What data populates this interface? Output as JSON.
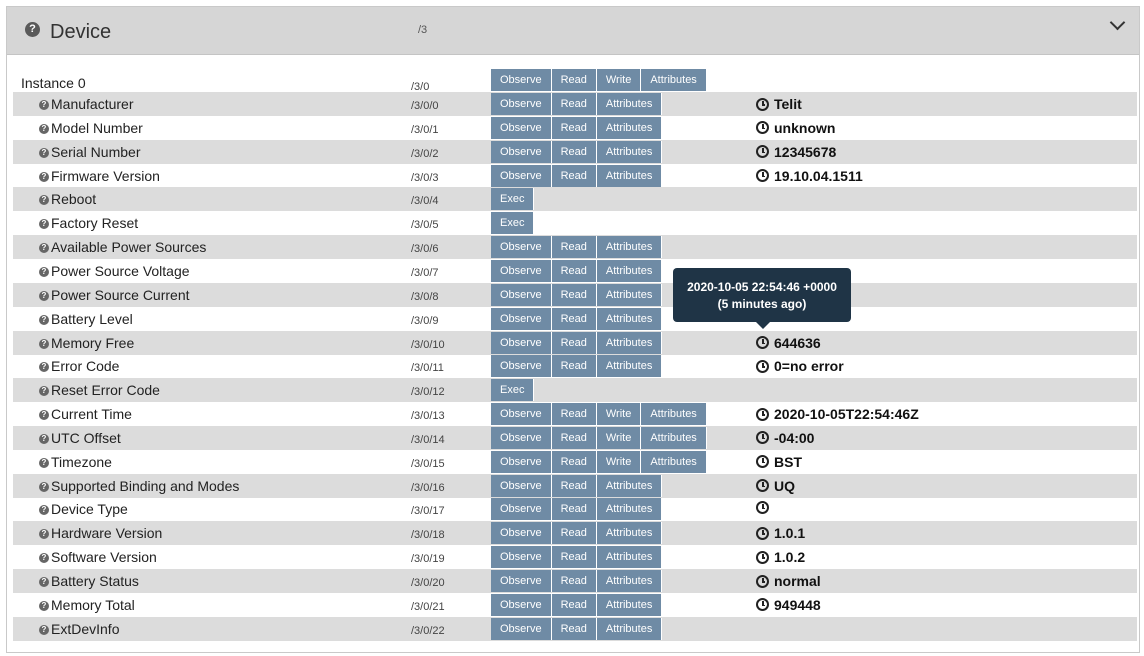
{
  "header": {
    "title": "Device",
    "path": "/3"
  },
  "instance": {
    "label": "Instance 0",
    "path": "/3/0",
    "buttons": [
      "Observe",
      "Read",
      "Write",
      "Attributes"
    ]
  },
  "resources": [
    {
      "name": "Manufacturer",
      "path": "/3/0/0",
      "buttons": [
        "Observe",
        "Read",
        "Attributes"
      ],
      "value": "Telit"
    },
    {
      "name": "Model Number",
      "path": "/3/0/1",
      "buttons": [
        "Observe",
        "Read",
        "Attributes"
      ],
      "value": "unknown"
    },
    {
      "name": "Serial Number",
      "path": "/3/0/2",
      "buttons": [
        "Observe",
        "Read",
        "Attributes"
      ],
      "value": "12345678"
    },
    {
      "name": "Firmware Version",
      "path": "/3/0/3",
      "buttons": [
        "Observe",
        "Read",
        "Attributes"
      ],
      "value": "19.10.04.1511"
    },
    {
      "name": "Reboot",
      "path": "/3/0/4",
      "buttons": [
        "Exec"
      ],
      "value": null
    },
    {
      "name": "Factory Reset",
      "path": "/3/0/5",
      "buttons": [
        "Exec"
      ],
      "value": null
    },
    {
      "name": "Available Power Sources",
      "path": "/3/0/6",
      "buttons": [
        "Observe",
        "Read",
        "Attributes"
      ],
      "value": null
    },
    {
      "name": "Power Source Voltage",
      "path": "/3/0/7",
      "buttons": [
        "Observe",
        "Read",
        "Attributes"
      ],
      "value": null
    },
    {
      "name": "Power Source Current",
      "path": "/3/0/8",
      "buttons": [
        "Observe",
        "Read",
        "Attributes"
      ],
      "value": null
    },
    {
      "name": "Battery Level",
      "path": "/3/0/9",
      "buttons": [
        "Observe",
        "Read",
        "Attributes"
      ],
      "value": null
    },
    {
      "name": "Memory Free",
      "path": "/3/0/10",
      "buttons": [
        "Observe",
        "Read",
        "Attributes"
      ],
      "value": "644636"
    },
    {
      "name": "Error Code",
      "path": "/3/0/11",
      "buttons": [
        "Observe",
        "Read",
        "Attributes"
      ],
      "value": "0=no error"
    },
    {
      "name": "Reset Error Code",
      "path": "/3/0/12",
      "buttons": [
        "Exec"
      ],
      "value": null
    },
    {
      "name": "Current Time",
      "path": "/3/0/13",
      "buttons": [
        "Observe",
        "Read",
        "Write",
        "Attributes"
      ],
      "value": "2020-10-05T22:54:46Z"
    },
    {
      "name": "UTC Offset",
      "path": "/3/0/14",
      "buttons": [
        "Observe",
        "Read",
        "Write",
        "Attributes"
      ],
      "value": "-04:00"
    },
    {
      "name": "Timezone",
      "path": "/3/0/15",
      "buttons": [
        "Observe",
        "Read",
        "Write",
        "Attributes"
      ],
      "value": "BST"
    },
    {
      "name": "Supported Binding and Modes",
      "path": "/3/0/16",
      "buttons": [
        "Observe",
        "Read",
        "Attributes"
      ],
      "value": "UQ"
    },
    {
      "name": "Device Type",
      "path": "/3/0/17",
      "buttons": [
        "Observe",
        "Read",
        "Attributes"
      ],
      "value": ""
    },
    {
      "name": "Hardware Version",
      "path": "/3/0/18",
      "buttons": [
        "Observe",
        "Read",
        "Attributes"
      ],
      "value": "1.0.1"
    },
    {
      "name": "Software Version",
      "path": "/3/0/19",
      "buttons": [
        "Observe",
        "Read",
        "Attributes"
      ],
      "value": "1.0.2"
    },
    {
      "name": "Battery Status",
      "path": "/3/0/20",
      "buttons": [
        "Observe",
        "Read",
        "Attributes"
      ],
      "value": "normal"
    },
    {
      "name": "Memory Total",
      "path": "/3/0/21",
      "buttons": [
        "Observe",
        "Read",
        "Attributes"
      ],
      "value": "949448"
    },
    {
      "name": "ExtDevInfo",
      "path": "/3/0/22",
      "buttons": [
        "Observe",
        "Read",
        "Attributes"
      ],
      "value": null
    }
  ],
  "tooltip": {
    "line1": "2020-10-05 22:54:46 +0000",
    "line2": "(5 minutes ago)"
  },
  "colors": {
    "button": "#6f8ba5",
    "header": "#d6d6d6",
    "row_alt": "#dcdcdc",
    "tooltip": "#1f3446"
  },
  "icons": {
    "help": "help-circle-icon",
    "timestamp": "clock-icon",
    "collapse": "chevron-down-icon"
  }
}
